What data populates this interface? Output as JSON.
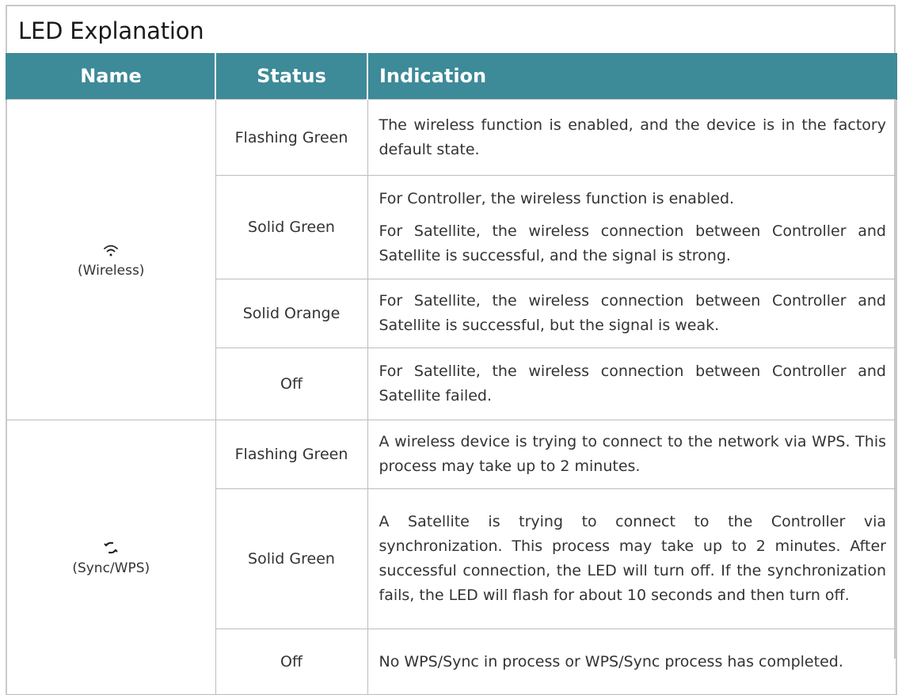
{
  "title": "LED Explanation",
  "headers": {
    "name": "Name",
    "status": "Status",
    "indication": "Indication"
  },
  "colors": {
    "header_bg": "#3d8a98",
    "border": "#bdbdbd"
  },
  "groups": [
    {
      "icon": "wifi-icon",
      "name": "(Wireless)",
      "rows": [
        {
          "status": "Flashing Green",
          "indication": [
            "The wireless function is enabled, and the device is in the factory default state."
          ]
        },
        {
          "status": "Solid Green",
          "indication": [
            "For Controller, the wireless function is enabled.",
            "For Satellite, the wireless connection between Controller and Satellite is successful, and the signal is strong."
          ]
        },
        {
          "status": "Solid Orange",
          "indication": [
            "For Satellite, the wireless connection between Controller and Satellite is successful, but the signal is weak."
          ]
        },
        {
          "status": "Off",
          "indication": [
            "For Satellite, the wireless connection between Controller and Satellite failed."
          ]
        }
      ]
    },
    {
      "icon": "sync-icon",
      "name": "(Sync/WPS)",
      "rows": [
        {
          "status": "Flashing Green",
          "indication": [
            "A wireless device is trying to connect to the network via WPS. This process may take up to 2 minutes."
          ]
        },
        {
          "status": "Solid Green",
          "indication": [
            "A Satellite is trying to connect to the Controller via synchronization. This process may take up to 2 minutes. After successful connection, the LED will turn off. If the synchronization fails, the LED will flash for about 10 seconds and then turn off."
          ]
        },
        {
          "status": "Off",
          "indication": [
            "No WPS/Sync in process or WPS/Sync process has completed."
          ]
        }
      ]
    }
  ]
}
